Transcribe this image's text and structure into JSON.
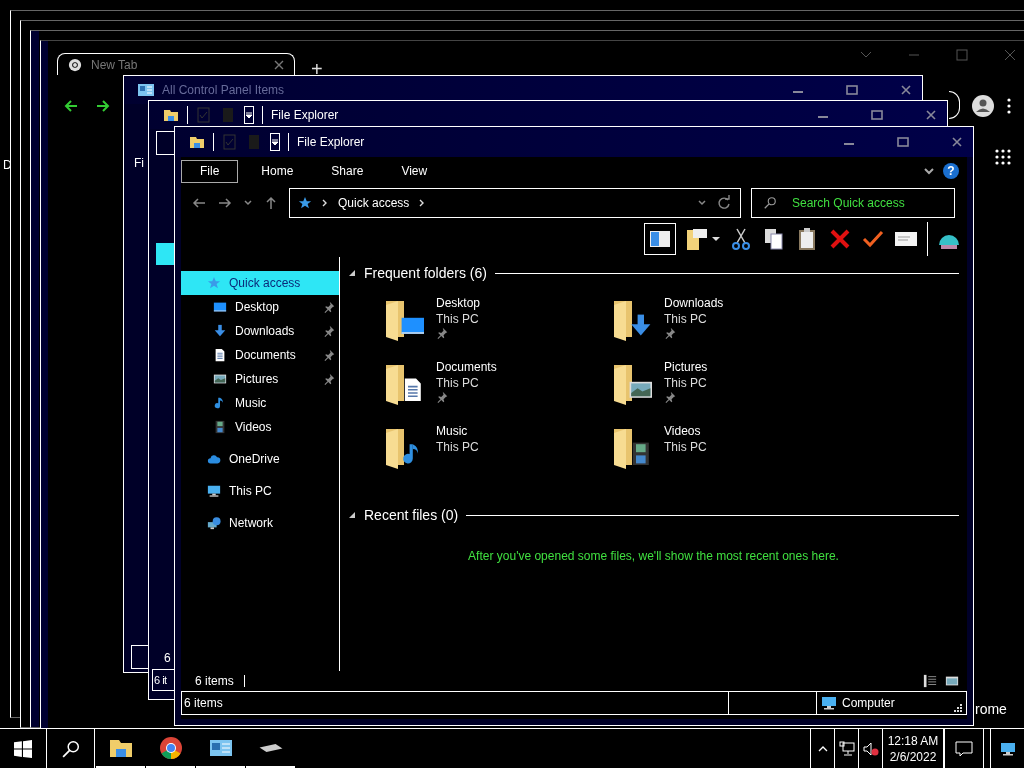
{
  "desktop": {
    "edge_text": "D"
  },
  "chrome": {
    "tab_title": "New Tab",
    "new_tab": "+",
    "edge_text": "rome"
  },
  "control_panel": {
    "title": "All Control Panel Items",
    "partial_text": "Fi"
  },
  "back_explorer": {
    "title": "File Explorer",
    "status_text": "6",
    "status_bar_text": "6 it"
  },
  "explorer": {
    "title": "File Explorer",
    "ribbon_tabs": [
      {
        "label": "File",
        "selected": true
      },
      {
        "label": "Home",
        "selected": false
      },
      {
        "label": "Share",
        "selected": false
      },
      {
        "label": "View",
        "selected": false
      }
    ],
    "help": "?",
    "address": {
      "path": "Quick access"
    },
    "search": {
      "placeholder": "Search Quick access"
    },
    "nav": [
      {
        "label": "Quick access",
        "kind": "quick",
        "selected": true,
        "children": [
          {
            "label": "Desktop",
            "kind": "desktop",
            "selected": false,
            "pinned": true
          },
          {
            "label": "Downloads",
            "kind": "downloads",
            "selected": false,
            "pinned": true
          },
          {
            "label": "Documents",
            "kind": "documents",
            "selected": false,
            "pinned": true
          },
          {
            "label": "Pictures",
            "kind": "pictures",
            "selected": false,
            "pinned": true
          },
          {
            "label": "Music",
            "kind": "music",
            "selected": false,
            "pinned": false
          },
          {
            "label": "Videos",
            "kind": "videos",
            "selected": false,
            "pinned": false
          }
        ]
      },
      {
        "label": "OneDrive",
        "kind": "onedrive",
        "selected": false
      },
      {
        "label": "This PC",
        "kind": "thispc",
        "selected": false
      },
      {
        "label": "Network",
        "kind": "network",
        "selected": false
      }
    ],
    "sections": [
      {
        "title": "Frequent folders (6)",
        "expanded": true,
        "folders": [
          {
            "name": "Desktop",
            "location": "This PC",
            "kind": "desktop",
            "pinned": true
          },
          {
            "name": "Downloads",
            "location": "This PC",
            "kind": "downloads",
            "pinned": true
          },
          {
            "name": "Documents",
            "location": "This PC",
            "kind": "documents",
            "pinned": true
          },
          {
            "name": "Pictures",
            "location": "This PC",
            "kind": "pictures",
            "pinned": true
          },
          {
            "name": "Music",
            "location": "This PC",
            "kind": "music",
            "pinned": false
          },
          {
            "name": "Videos",
            "location": "This PC",
            "kind": "videos",
            "pinned": false
          }
        ]
      },
      {
        "title": "Recent files (0)",
        "expanded": true,
        "message": "After you've opened some files, we'll show the most recent ones here."
      }
    ],
    "status": "6 items",
    "status_bar": {
      "items": "6 items",
      "location": "Computer"
    }
  },
  "taskbar": {
    "time": "12:18 AM",
    "date": "2/6/2022"
  }
}
